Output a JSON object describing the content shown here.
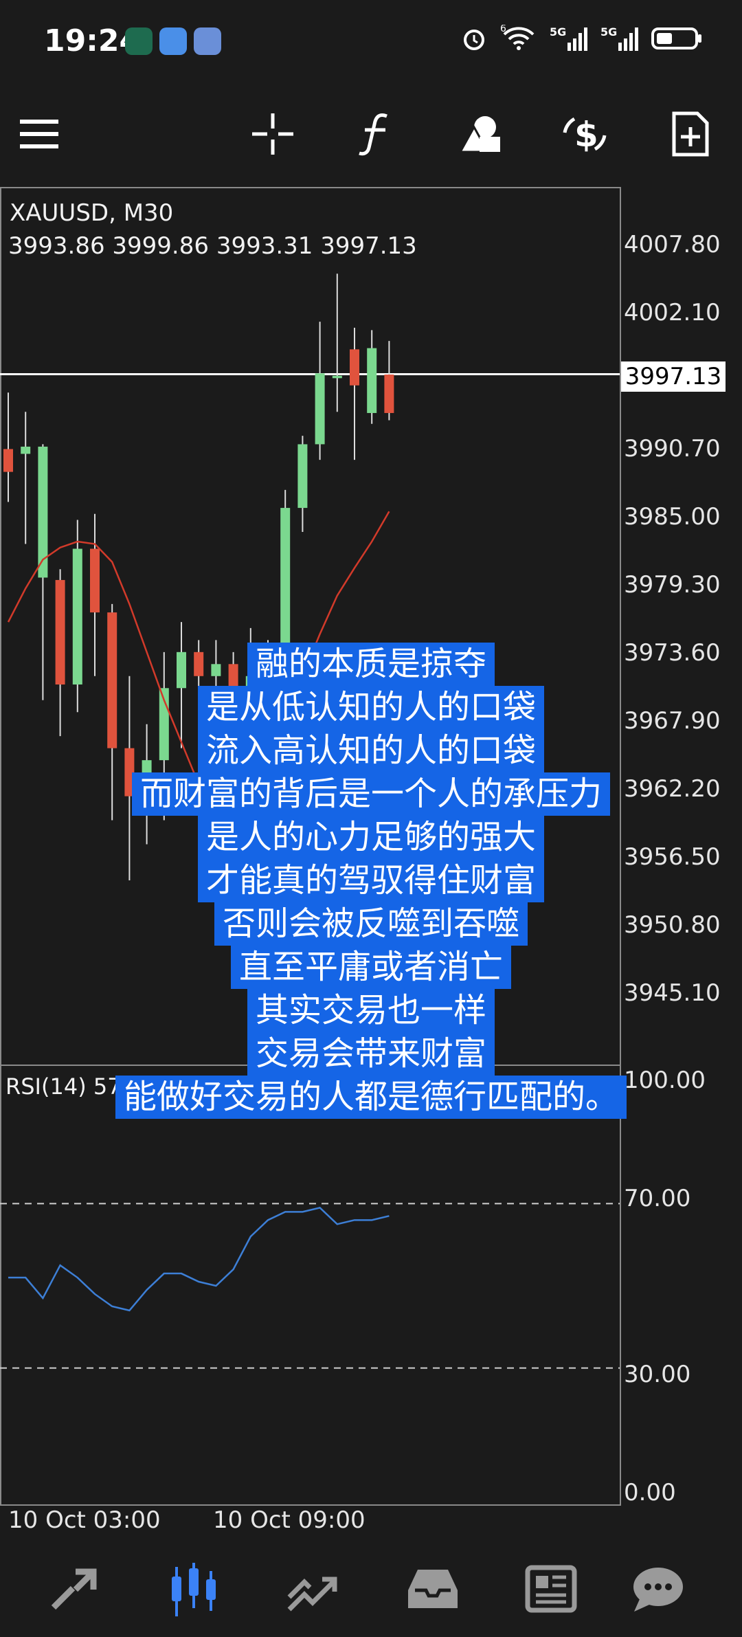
{
  "status_bar": {
    "time": "19:24",
    "notification_icons": [
      "app-icon-green",
      "message-icon",
      "shield-app-icon"
    ],
    "right_icons": [
      "alarm-icon",
      "wifi-icon",
      "5g-signal-icon",
      "5g-signal-icon",
      "battery-icon"
    ],
    "signal_label_1": "5G",
    "signal_label_2": "5G",
    "wifi_label": "6"
  },
  "toolbar": {
    "items": [
      "menu-icon",
      "crosshair-icon",
      "function-icon",
      "shapes-icon",
      "trade-icon",
      "new-order-icon"
    ]
  },
  "chart": {
    "symbol": "XAUUSD, M30",
    "ohlc": "3993.86 3999.86 3993.31 3997.13",
    "current_price": "3997.13",
    "price_axis": [
      "4007.80",
      "4002.10",
      "3990.70",
      "3985.00",
      "3979.30",
      "3973.60",
      "3967.90",
      "3962.20",
      "3956.50",
      "3950.80",
      "3945.10"
    ],
    "rsi_label": "RSI(14) 57.96",
    "rsi_axis": [
      "100.00",
      "70.00",
      "30.00",
      "0.00"
    ],
    "time_axis": [
      "10 Oct 03:00",
      "10 Oct 09:00"
    ],
    "colors": {
      "bull": "#7bd88f",
      "bear": "#e0533d",
      "ma": "#d23a2a",
      "rsi": "#3d7fd6",
      "price_line": "#ffffff"
    }
  },
  "chart_data": {
    "type": "candlestick",
    "price_axis_range": [
      3940,
      4010
    ],
    "candles": [
      {
        "o": 3990.9,
        "h": 3995.6,
        "l": 3986.5,
        "c": 3989.0
      },
      {
        "o": 3990.5,
        "h": 3994.0,
        "l": 3983.0,
        "c": 3991.1
      },
      {
        "o": 3980.2,
        "h": 3991.3,
        "l": 3970.0,
        "c": 3991.1
      },
      {
        "o": 3980.0,
        "h": 3980.9,
        "l": 3967.0,
        "c": 3971.3
      },
      {
        "o": 3971.3,
        "h": 3985.0,
        "l": 3969.0,
        "c": 3982.6
      },
      {
        "o": 3982.6,
        "h": 3985.5,
        "l": 3972.0,
        "c": 3977.3
      },
      {
        "o": 3977.3,
        "h": 3978.0,
        "l": 3960.0,
        "c": 3966.0
      },
      {
        "o": 3966.0,
        "h": 3972.0,
        "l": 3955.0,
        "c": 3962.0
      },
      {
        "o": 3962.0,
        "h": 3968.0,
        "l": 3958.0,
        "c": 3965.0
      },
      {
        "o": 3965.0,
        "h": 3974.0,
        "l": 3960.0,
        "c": 3971.0
      },
      {
        "o": 3971.0,
        "h": 3976.5,
        "l": 3966.0,
        "c": 3974.0
      },
      {
        "o": 3974.0,
        "h": 3975.0,
        "l": 3968.0,
        "c": 3972.0
      },
      {
        "o": 3972.0,
        "h": 3975.0,
        "l": 3967.0,
        "c": 3973.0
      },
      {
        "o": 3973.0,
        "h": 3974.0,
        "l": 3968.0,
        "c": 3970.0
      },
      {
        "o": 3970.0,
        "h": 3976.0,
        "l": 3965.0,
        "c": 3972.0
      },
      {
        "o": 3972.0,
        "h": 3975.0,
        "l": 3967.0,
        "c": 3971.5
      },
      {
        "o": 3971.5,
        "h": 3987.5,
        "l": 3969.0,
        "c": 3986.0
      },
      {
        "o": 3986.0,
        "h": 3992.0,
        "l": 3984.0,
        "c": 3991.3
      },
      {
        "o": 3991.3,
        "h": 4001.5,
        "l": 3990.0,
        "c": 3997.2
      },
      {
        "o": 3996.8,
        "h": 4005.5,
        "l": 3994.0,
        "c": 3997.0
      },
      {
        "o": 3999.2,
        "h": 4001.0,
        "l": 3990.0,
        "c": 3996.2
      },
      {
        "o": 3993.9,
        "h": 4000.8,
        "l": 3993.0,
        "c": 3999.3
      },
      {
        "o": 3997.1,
        "h": 3999.9,
        "l": 3993.3,
        "c": 3993.9
      }
    ],
    "ma": [
      3976.5,
      3979.3,
      3981.7,
      3982.7,
      3983.2,
      3983.0,
      3981.5,
      3978.0,
      3974.0,
      3970.0,
      3966.5,
      3963.0,
      3961.0,
      3960.0,
      3961.0,
      3964.0,
      3968.0,
      3972.0,
      3975.5,
      3978.7,
      3981.0,
      3983.2,
      3985.7
    ],
    "rsi_axis_range": [
      0,
      100
    ],
    "rsi": [
      52,
      52,
      47,
      55,
      52,
      48,
      45,
      44,
      49,
      53,
      53,
      51,
      50,
      54,
      62,
      66,
      68,
      68,
      69,
      65,
      66,
      66,
      67
    ]
  },
  "overlay_text": [
    "融的本质是掠夺",
    "是从低认知的人的口袋",
    "流入高认知的人的口袋",
    "而财富的背后是一个人的承压力",
    "是人的心力足够的强大",
    "才能真的驾驭得住财富",
    "否则会被反噬到吞噬",
    "直至平庸或者消亡",
    "其实交易也一样",
    "交易会带来财富",
    "能做好交易的人都是德行匹配的。"
  ],
  "bottom_nav": {
    "items": [
      "quotes-icon",
      "chart-icon",
      "trade-icon",
      "history-icon",
      "news-icon",
      "messages-icon"
    ],
    "active": "chart-icon",
    "accent": "#3b82f6"
  }
}
